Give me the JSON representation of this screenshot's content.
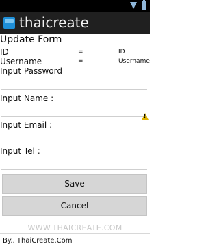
{
  "status_bar": {
    "wifi_icon": "wifi-signal-icon",
    "battery_icon": "battery-icon"
  },
  "app": {
    "title": "thaicreate",
    "icon": "app-logo-icon"
  },
  "form": {
    "title": "Update Form",
    "rows": [
      {
        "label": "ID",
        "separator": "=",
        "value": "ID"
      },
      {
        "label": "Username",
        "separator": "=",
        "value": "Username"
      }
    ],
    "fields": {
      "password": {
        "label": "Input Password",
        "value": ""
      },
      "name": {
        "label": "Input Name :",
        "value": ""
      },
      "email": {
        "label": "Input Email :",
        "value": ""
      },
      "tel": {
        "label": "Input Tel :",
        "value": ""
      }
    },
    "warning_icon": "warning-icon",
    "save_label": "Save",
    "cancel_label": "Cancel"
  },
  "watermark": "WWW.THAICREATE.COM",
  "footer": "By.. ThaiCreate.Com"
}
